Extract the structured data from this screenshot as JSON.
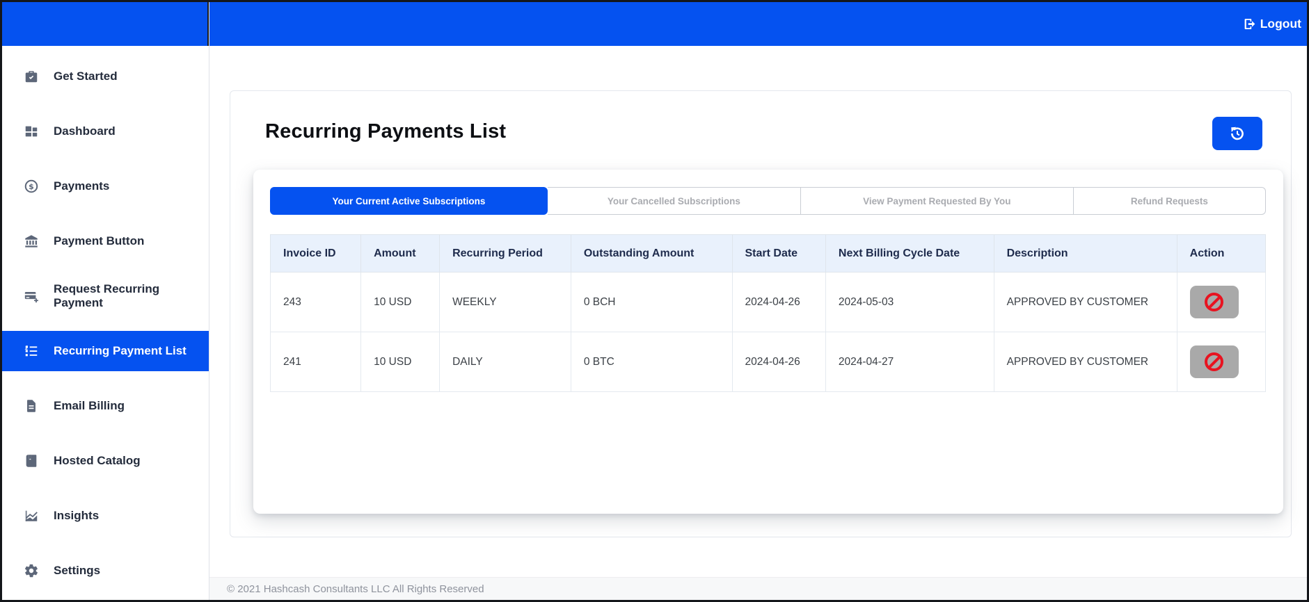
{
  "colors": {
    "primary_blue": "#0552f0",
    "danger_red": "#e81320",
    "action_button_gray": "#a9a9a9",
    "table_header_bg": "#e9f1fc",
    "inactive_tab_text": "#a9abb0"
  },
  "topbar": {
    "logout_label": "Logout"
  },
  "icons": {
    "logout": "sign-out-arrow-box",
    "refresh": "history-counterclockwise-arrow",
    "row_action": "no-entry-ban-circle-slash",
    "sidebar": [
      "briefcase-check",
      "dashboard-grid",
      "dollar-circle",
      "bank-columns",
      "card-plus",
      "bullet-list",
      "document-lines",
      "book",
      "line-chart",
      "gear"
    ]
  },
  "sidebar": {
    "items": [
      {
        "label": "Get Started",
        "active": false
      },
      {
        "label": "Dashboard",
        "active": false
      },
      {
        "label": "Payments",
        "active": false
      },
      {
        "label": "Payment Button",
        "active": false
      },
      {
        "label": "Request Recurring Payment",
        "active": false
      },
      {
        "label": "Recurring Payment List",
        "active": true
      },
      {
        "label": "Email Billing",
        "active": false
      },
      {
        "label": "Hosted Catalog",
        "active": false
      },
      {
        "label": "Insights",
        "active": false
      },
      {
        "label": "Settings",
        "active": false
      }
    ]
  },
  "main": {
    "title": "Recurring Payments List",
    "tabs": [
      {
        "label": "Your Current Active Subscriptions",
        "active": true
      },
      {
        "label": "Your Cancelled Subscriptions",
        "active": false
      },
      {
        "label": "View Payment Requested By You",
        "active": false
      },
      {
        "label": "Refund Requests",
        "active": false
      }
    ],
    "table": {
      "headers": [
        "Invoice ID",
        "Amount",
        "Recurring Period",
        "Outstanding Amount",
        "Start Date",
        "Next Billing Cycle Date",
        "Description",
        "Action"
      ],
      "rows": [
        {
          "invoice_id": "243",
          "amount": "10 USD",
          "recurring_period": "WEEKLY",
          "outstanding_amount": "0 BCH",
          "start_date": "2024-04-26",
          "next_billing_cycle_date": "2024-05-03",
          "description": "APPROVED BY CUSTOMER"
        },
        {
          "invoice_id": "241",
          "amount": "10 USD",
          "recurring_period": "DAILY",
          "outstanding_amount": "0 BTC",
          "start_date": "2024-04-26",
          "next_billing_cycle_date": "2024-04-27",
          "description": "APPROVED BY CUSTOMER"
        }
      ]
    }
  },
  "footer": {
    "copyright": "© 2021 Hashcash Consultants LLC All Rights Reserved"
  }
}
